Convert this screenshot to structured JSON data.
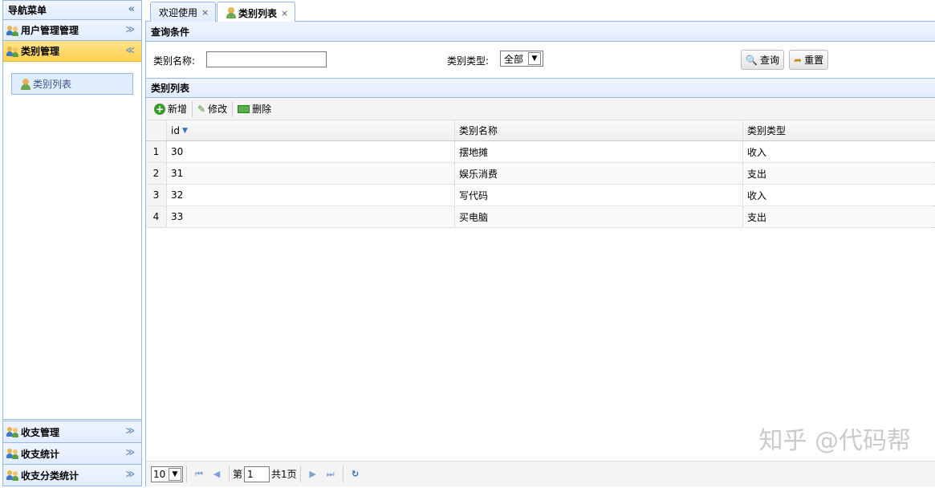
{
  "sidebar": {
    "title": "导航菜单",
    "collapse_glyph": "«",
    "sections": [
      {
        "label": "用户管理管理",
        "chevron": "≫"
      },
      {
        "label": "类别管理",
        "chevron": "≪"
      }
    ],
    "active_item": "类别列表",
    "bottom_sections": [
      {
        "label": "收支管理",
        "chevron": "≫"
      },
      {
        "label": "收支统计",
        "chevron": "≫"
      },
      {
        "label": "收支分类统计",
        "chevron": "≫"
      }
    ]
  },
  "tabs": [
    {
      "label": "欢迎使用",
      "close": "×"
    },
    {
      "label": "类别列表",
      "close": "×"
    }
  ],
  "query": {
    "header": "查询条件",
    "name_label": "类别名称:",
    "name_value": "",
    "type_label": "类别类型:",
    "type_selected": "全部",
    "search_button": "查询",
    "reset_button": "重置"
  },
  "list": {
    "header": "类别列表",
    "toolbar": {
      "add": "新增",
      "edit": "修改",
      "delete": "删除"
    },
    "columns": [
      "id",
      "类别名称",
      "类别类型"
    ],
    "rows": [
      {
        "n": "1",
        "id": "30",
        "name": "摆地摊",
        "type": "收入"
      },
      {
        "n": "2",
        "id": "31",
        "name": "娱乐消费",
        "type": "支出"
      },
      {
        "n": "3",
        "id": "32",
        "name": "写代码",
        "type": "收入"
      },
      {
        "n": "4",
        "id": "33",
        "name": "买电脑",
        "type": "支出"
      }
    ]
  },
  "pager": {
    "page_size": "10",
    "page_prefix": "第",
    "page_value": "1",
    "page_total": "共1页"
  },
  "watermark": "知乎 @代码帮"
}
